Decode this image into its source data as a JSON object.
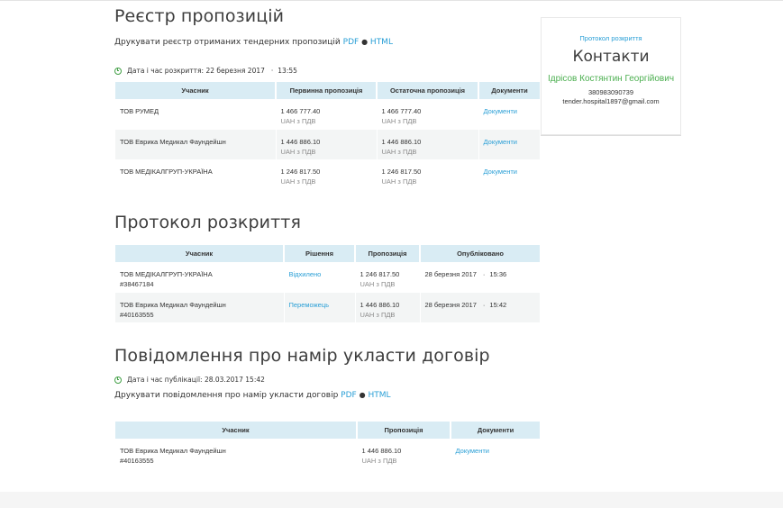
{
  "registry": {
    "title": "Реєстр пропозицій",
    "print_text": "Друкувати реєстр отриманих тендерних пропозицій",
    "pdf": "PDF",
    "dot": "●",
    "html": "HTML",
    "date_text": "Дата і час розкриття: 22 березня 2017",
    "date_sep": "·",
    "time_text": "13:55",
    "headers": [
      "Учасник",
      "Первинна пропозиція",
      "Остаточна пропозиція",
      "Документи"
    ],
    "rows": [
      {
        "participant": "ТОВ РУМЕД",
        "initial": "1 466 777.40",
        "initial_sub": "UAH з ПДВ",
        "final": "1 466 777.40",
        "final_sub": "UAH з ПДВ",
        "docs": "Документи"
      },
      {
        "participant": "ТОВ Еврика Медикал Фаундейшн",
        "initial": "1 446 886.10",
        "initial_sub": "UAH з ПДВ",
        "final": "1 446 886.10",
        "final_sub": "UAH з ПДВ",
        "docs": "Документи"
      },
      {
        "participant": "ТОВ МЕДІКАЛГРУП-УКРАЇНА",
        "initial": "1 246 817.50",
        "initial_sub": "UAH з ПДВ",
        "final": "1 246 817.50",
        "final_sub": "UAH з ПДВ",
        "docs": "Документи"
      }
    ]
  },
  "protocol": {
    "title": "Протокол розкриття",
    "headers": [
      "Учасник",
      "Рішення",
      "Пропозиція",
      "Опубліковано"
    ],
    "rows": [
      {
        "participant": "ТОВ МЕДІКАЛГРУП-УКРАЇНА",
        "id": "#38467184",
        "decision": "Відхилено",
        "offer": "1 246 817.50",
        "offer_sub": "UAH з ПДВ",
        "published": "28 березня 2017",
        "sep": "·",
        "time": "15:36"
      },
      {
        "participant": "ТОВ Еврика Медикал Фаундейшн",
        "id": "#40163555",
        "decision": "Переможець",
        "offer": "1 446 886.10",
        "offer_sub": "UAH з ПДВ",
        "published": "28 березня 2017",
        "sep": "·",
        "time": "15:42"
      }
    ]
  },
  "notice": {
    "title": "Повідомлення про намір укласти договір",
    "date_text": "Дата і час публікації: 28.03.2017 15:42",
    "print_text": "Друкувати повідомлення про намір укласти договір",
    "pdf": "PDF",
    "dot": "●",
    "html": "HTML",
    "headers": [
      "Учасник",
      "Пропозиція",
      "Документи"
    ],
    "rows": [
      {
        "participant": "ТОВ Еврика Медикал Фаундейшн",
        "id": "#40163555",
        "offer": "1 446 886.10",
        "offer_sub": "UAH з ПДВ",
        "docs": "Документи"
      }
    ]
  },
  "sidebar": {
    "link": "Протокол розкриття",
    "title": "Контакти",
    "name": "Ідрісов Костянтин Георгійович",
    "phone": "380983090739",
    "email": "tender.hospital1897@gmail.com"
  },
  "colors": {
    "link": "#2a9fd6",
    "header_bg": "#d9ecf4",
    "accent_green": "#4caf50",
    "clock_icon": "#43a047"
  },
  "icons": {
    "date": "clock-icon"
  }
}
